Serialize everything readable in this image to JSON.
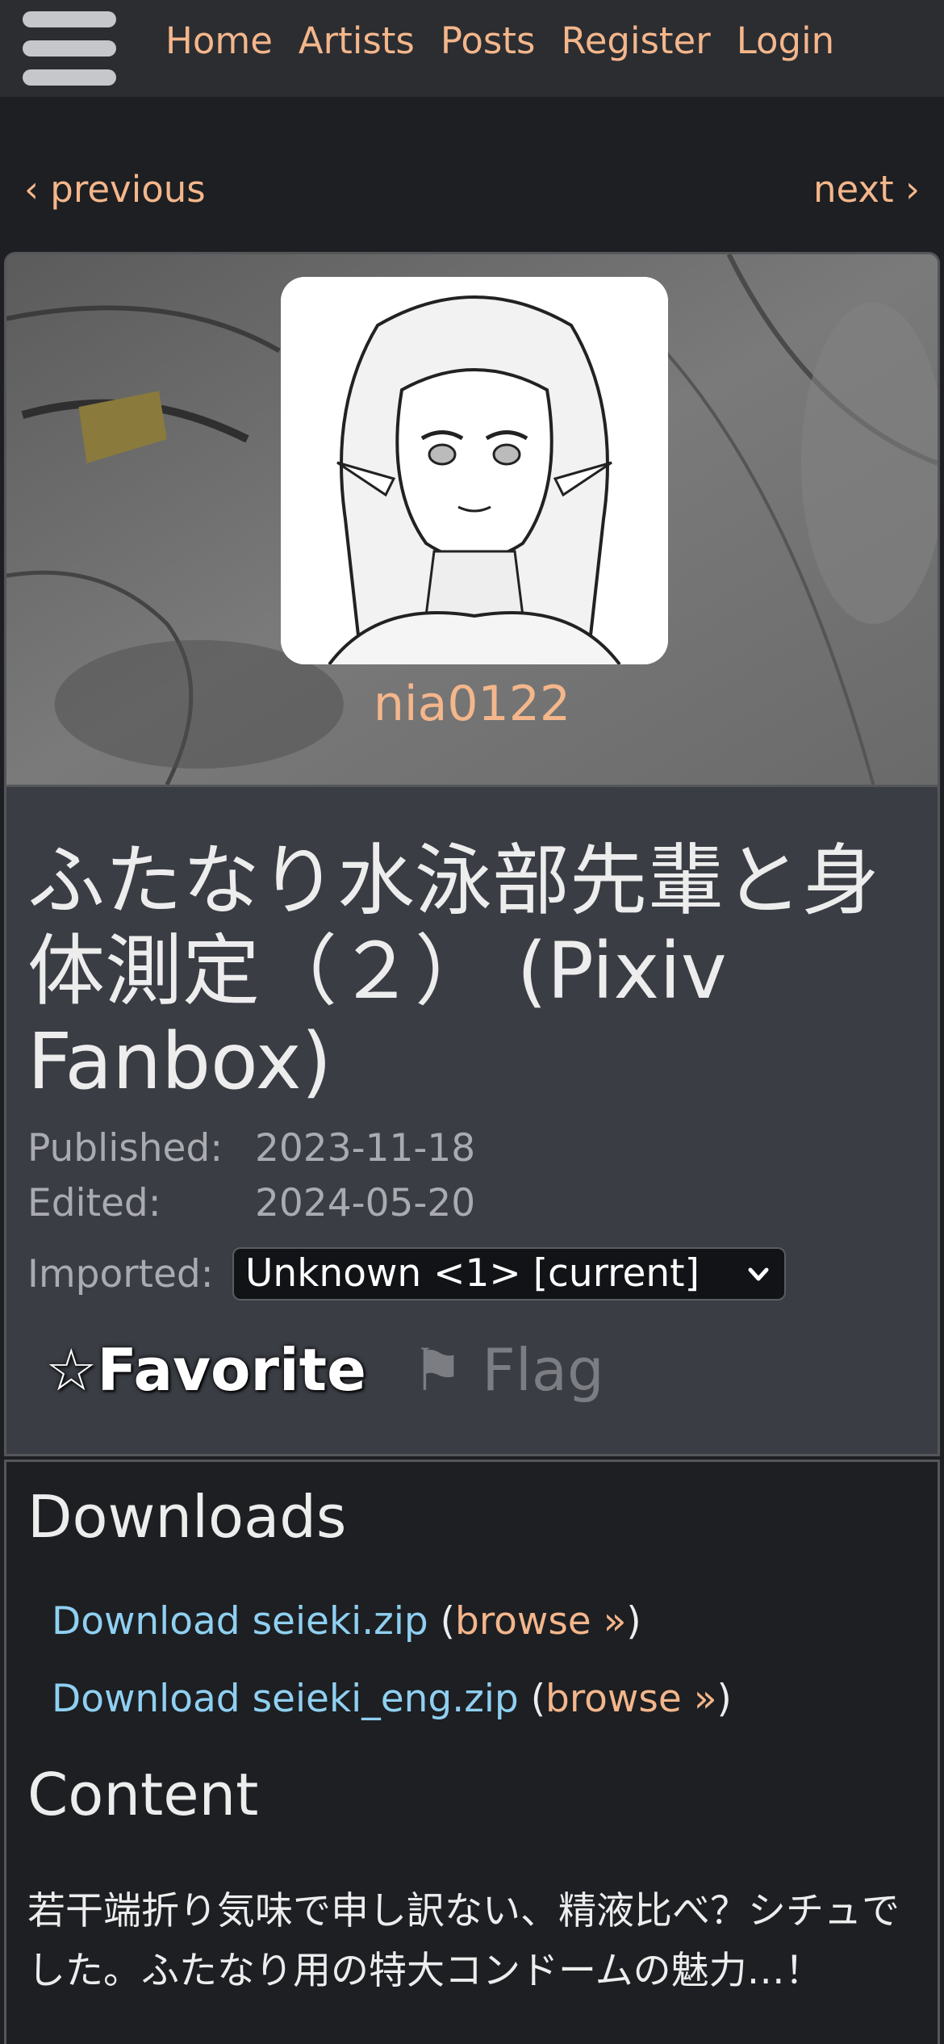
{
  "nav": {
    "menu_icon": "hamburger-menu-icon",
    "items": [
      "Home",
      "Artists",
      "Posts",
      "Register",
      "Login"
    ]
  },
  "pager": {
    "previous": "‹ previous",
    "next": "next ›"
  },
  "artist": {
    "name": "nia0122"
  },
  "post": {
    "title": "ふたなり水泳部先輩と身体測定（２） (Pixiv Fanbox)",
    "published_label": "Published:",
    "published": "2023-11-18",
    "edited_label": "Edited:",
    "edited": "2024-05-20",
    "imported_label": "Imported:",
    "imported_value": "Unknown <1> [current]",
    "favorite": "☆Favorite",
    "flag": "⚑ Flag"
  },
  "downloads": {
    "heading": "Downloads",
    "items": [
      {
        "label": "Download seieki.zip",
        "browse": "browse »"
      },
      {
        "label": "Download seieki_eng.zip",
        "browse": "browse »"
      }
    ]
  },
  "content": {
    "heading": "Content",
    "text": "若干端折り気味で申し訳ない、精液比べ？シチュでした。ふたなり用の特大コンドームの魅力…！"
  },
  "colors": {
    "link_orange": "#f4b68b",
    "link_blue": "#8fd0f2",
    "background": "#1d1f22",
    "panel": "#3a3d44"
  }
}
